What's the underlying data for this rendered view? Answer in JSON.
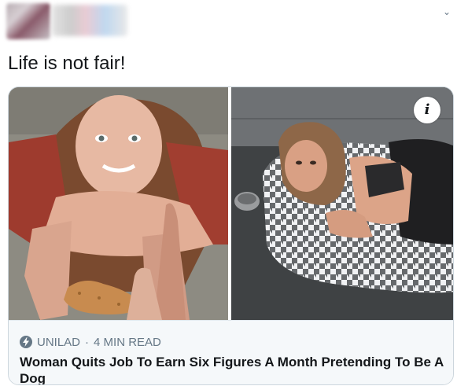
{
  "tweet": {
    "text": "Life is not fair!"
  },
  "card": {
    "source": "UNILAD",
    "separator": "·",
    "read_time": "4 MIN READ",
    "headline": "Woman Quits Job To Earn Six Figures A Month Pretending To Be A Dog",
    "info_label": "i"
  },
  "icons": {
    "more": "chevron-down-icon",
    "source": "lightning-bolt-icon",
    "info": "info-icon"
  },
  "colors": {
    "text_primary": "#14171a",
    "text_secondary": "#657786",
    "card_border": "#ccd6dd",
    "card_footer_bg": "#f5f8fa"
  }
}
